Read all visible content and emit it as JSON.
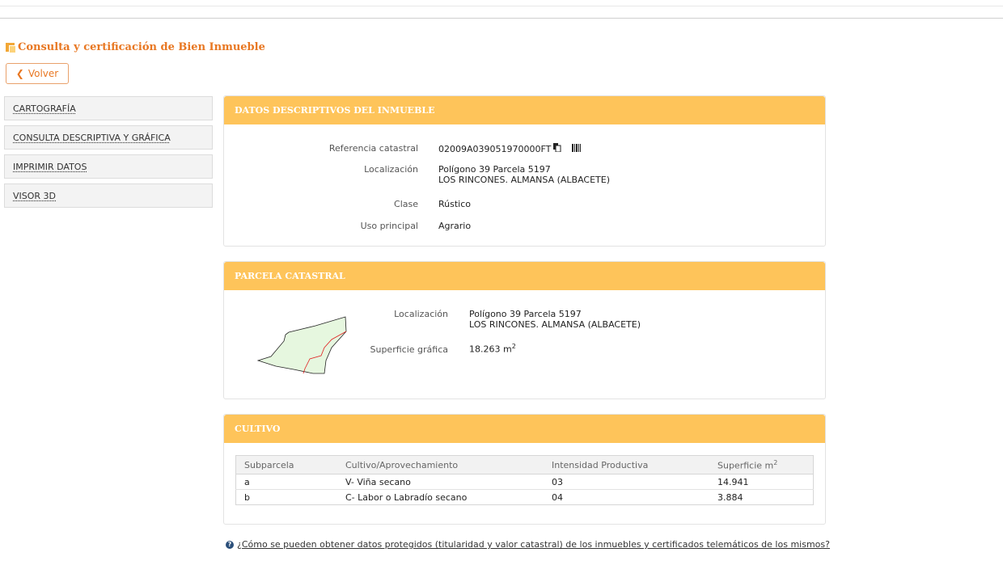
{
  "page": {
    "title": "Consulta y certificación de Bien Inmueble",
    "back_label": "Volver"
  },
  "sidebar": {
    "items": [
      {
        "label": "CARTOGRAFÍA"
      },
      {
        "label": "CONSULTA DESCRIPTIVA Y GRÁFICA"
      },
      {
        "label": "IMPRIMIR DATOS"
      },
      {
        "label": "VISOR 3D"
      }
    ]
  },
  "datos": {
    "header": "DATOS DESCRIPTIVOS DEL INMUEBLE",
    "ref_label": "Referencia catastral",
    "ref_value": "02009A039051970000FT",
    "loc_label": "Localización",
    "loc_line1": "Polígono 39 Parcela 5197",
    "loc_line2": "LOS RINCONES. ALMANSA (ALBACETE)",
    "clase_label": "Clase",
    "clase_value": "Rústico",
    "uso_label": "Uso principal",
    "uso_value": "Agrario"
  },
  "parcela": {
    "header": "PARCELA CATASTRAL",
    "loc_label": "Localización",
    "loc_line1": "Polígono 39 Parcela 5197",
    "loc_line2": "LOS RINCONES. ALMANSA (ALBACETE)",
    "sup_label": "Superficie gráfica",
    "sup_value": "18.263 m",
    "sup_unit_exp": "2"
  },
  "cultivo": {
    "header": "CULTIVO",
    "columns": [
      "Subparcela",
      "Cultivo/Aprovechamiento",
      "Intensidad Productiva",
      "Superficie m"
    ],
    "sup_exp": "2",
    "rows": [
      [
        "a",
        "V- Viña secano",
        "03",
        "14.941"
      ],
      [
        "b",
        "C- Labor o Labradío secano",
        "04",
        "3.884"
      ]
    ]
  },
  "help": {
    "text": "¿Cómo se pueden obtener datos protegidos (titularidad y valor catastral) de los inmuebles y certificados telemáticos de los mismos?"
  },
  "colors": {
    "accent": "#e87722",
    "panel_header": "#fec45a",
    "parcel_fill": "#e6f7df",
    "subparcel_line": "#e02020"
  },
  "icons": [
    "copy-icon",
    "barcode-icon",
    "chevron-left-icon",
    "question-circle-icon"
  ]
}
